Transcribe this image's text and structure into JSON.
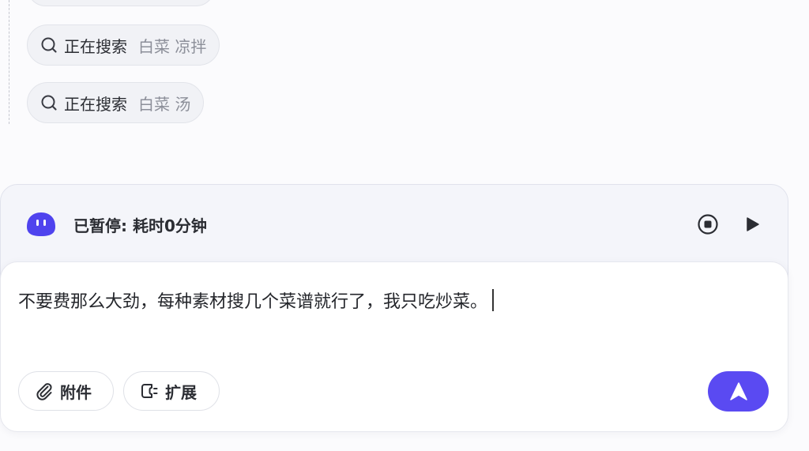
{
  "search_steps": [
    {
      "status": "正在搜索",
      "query": "白菜 凉拌",
      "icon": "search-icon"
    },
    {
      "status": "正在搜索",
      "query": "白菜 汤",
      "icon": "search-icon"
    }
  ],
  "task_status": {
    "text": "已暂停: 耗时0分钟",
    "avatar_icon": "bot-avatar-icon",
    "stop_icon": "stop-icon",
    "play_icon": "play-icon"
  },
  "composer": {
    "value": "不要费那么大劲，每种素材搜几个菜谱就行了，我只吃炒菜。",
    "attach_label": "附件",
    "attach_icon": "paperclip-icon",
    "expand_label": "扩展",
    "expand_icon": "plugin-icon",
    "send_icon": "send-arrow-icon"
  },
  "colors": {
    "accent": "#5a4af2",
    "chip_bg": "#f1f2f6",
    "muted_text": "#8c8f99"
  }
}
